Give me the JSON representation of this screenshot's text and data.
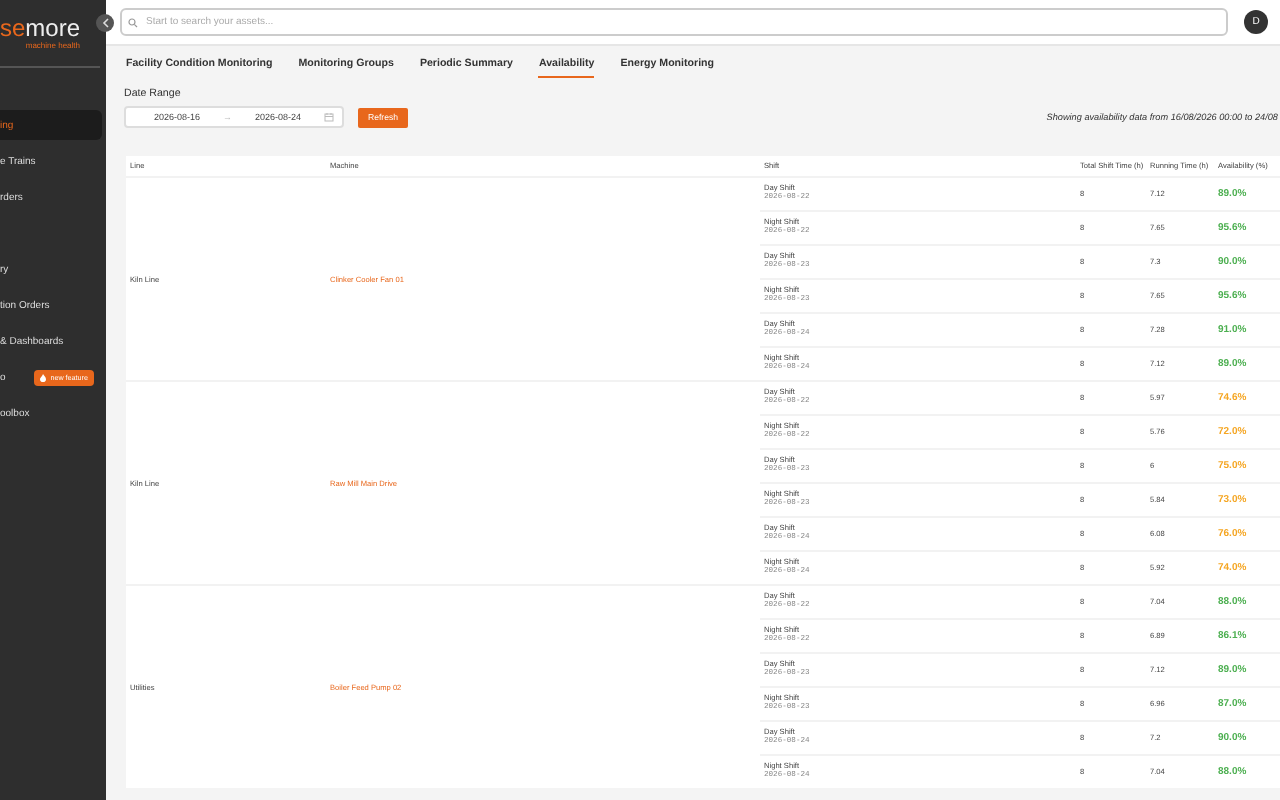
{
  "logo": {
    "brand_start": "se",
    "brand_end": "more",
    "tagline": "machine health"
  },
  "sidebar": {
    "items": [
      {
        "label": "ing",
        "selected": true
      },
      {
        "label": "e Trains",
        "selected": false
      },
      {
        "label": "rders",
        "selected": false
      },
      {
        "label": "ry",
        "selected": false
      },
      {
        "label": "tion Orders",
        "selected": false
      },
      {
        "label": "& Dashboards",
        "selected": false
      },
      {
        "label": "o",
        "selected": false,
        "badge": "new feature"
      },
      {
        "label": "oolbox",
        "selected": false
      }
    ]
  },
  "search": {
    "placeholder": "Start to search your assets..."
  },
  "avatar": {
    "initial": "D"
  },
  "tabs": [
    {
      "label": "Facility Condition Monitoring",
      "selected": false
    },
    {
      "label": "Monitoring Groups",
      "selected": false
    },
    {
      "label": "Periodic Summary",
      "selected": false
    },
    {
      "label": "Availability",
      "selected": true
    },
    {
      "label": "Energy Monitoring",
      "selected": false
    }
  ],
  "date_range": {
    "label": "Date Range",
    "start": "2026-08-16",
    "separator": "→",
    "end": "2026-08-24",
    "button": "Refresh"
  },
  "info": "Showing availability data from 16/08/2026 00:00 to 24/08",
  "table": {
    "columns": [
      "Line",
      "Machine",
      "Shift",
      "Total Shift Time (h)",
      "Running Time (h)",
      "Availability (%)"
    ],
    "groups": [
      {
        "line": "Kiln Line",
        "machine": "Clinker Cooler Fan 01",
        "rows": [
          {
            "shift": "Day Shift",
            "date": "2026-08-22",
            "total": "8",
            "running": "7.12",
            "availability": "89.0%",
            "color": "#4caf50"
          },
          {
            "shift": "Night Shift",
            "date": "2026-08-22",
            "total": "8",
            "running": "7.65",
            "availability": "95.6%",
            "color": "#4caf50"
          },
          {
            "shift": "Day Shift",
            "date": "2026-08-23",
            "total": "8",
            "running": "7.3",
            "availability": "90.0%",
            "color": "#4caf50"
          },
          {
            "shift": "Night Shift",
            "date": "2026-08-23",
            "total": "8",
            "running": "7.65",
            "availability": "95.6%",
            "color": "#4caf50"
          },
          {
            "shift": "Day Shift",
            "date": "2026-08-24",
            "total": "8",
            "running": "7.28",
            "availability": "91.0%",
            "color": "#4caf50"
          },
          {
            "shift": "Night Shift",
            "date": "2026-08-24",
            "total": "8",
            "running": "7.12",
            "availability": "89.0%",
            "color": "#4caf50"
          }
        ]
      },
      {
        "line": "Kiln Line",
        "machine": "Raw Mill Main Drive",
        "rows": [
          {
            "shift": "Day Shift",
            "date": "2026-08-22",
            "total": "8",
            "running": "5.97",
            "availability": "74.6%",
            "color": "#f5a623"
          },
          {
            "shift": "Night Shift",
            "date": "2026-08-22",
            "total": "8",
            "running": "5.76",
            "availability": "72.0%",
            "color": "#f5a623"
          },
          {
            "shift": "Day Shift",
            "date": "2026-08-23",
            "total": "8",
            "running": "6",
            "availability": "75.0%",
            "color": "#f5a623"
          },
          {
            "shift": "Night Shift",
            "date": "2026-08-23",
            "total": "8",
            "running": "5.84",
            "availability": "73.0%",
            "color": "#f5a623"
          },
          {
            "shift": "Day Shift",
            "date": "2026-08-24",
            "total": "8",
            "running": "6.08",
            "availability": "76.0%",
            "color": "#f5a623"
          },
          {
            "shift": "Night Shift",
            "date": "2026-08-24",
            "total": "8",
            "running": "5.92",
            "availability": "74.0%",
            "color": "#f5a623"
          }
        ]
      },
      {
        "line": "Utilities",
        "machine": "Boiler Feed Pump 02",
        "rows": [
          {
            "shift": "Day Shift",
            "date": "2026-08-22",
            "total": "8",
            "running": "7.04",
            "availability": "88.0%",
            "color": "#4caf50"
          },
          {
            "shift": "Night Shift",
            "date": "2026-08-22",
            "total": "8",
            "running": "6.89",
            "availability": "86.1%",
            "color": "#4caf50"
          },
          {
            "shift": "Day Shift",
            "date": "2026-08-23",
            "total": "8",
            "running": "7.12",
            "availability": "89.0%",
            "color": "#4caf50"
          },
          {
            "shift": "Night Shift",
            "date": "2026-08-23",
            "total": "8",
            "running": "6.96",
            "availability": "87.0%",
            "color": "#4caf50"
          },
          {
            "shift": "Day Shift",
            "date": "2026-08-24",
            "total": "8",
            "running": "7.2",
            "availability": "90.0%",
            "color": "#4caf50"
          },
          {
            "shift": "Night Shift",
            "date": "2026-08-24",
            "total": "8",
            "running": "7.04",
            "availability": "88.0%",
            "color": "#4caf50"
          }
        ]
      }
    ]
  }
}
